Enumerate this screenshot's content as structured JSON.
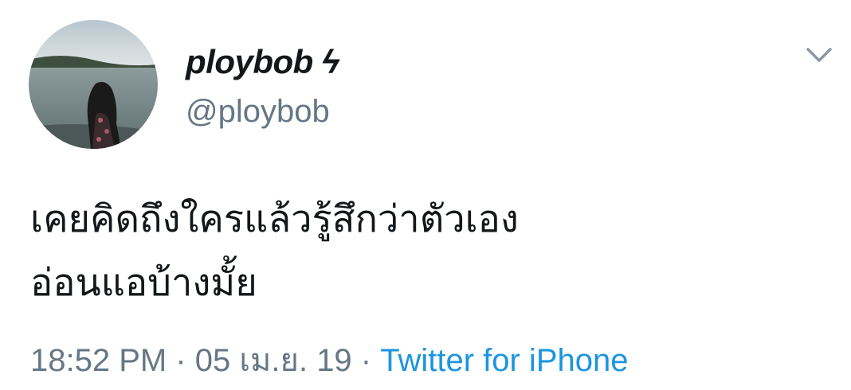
{
  "user": {
    "display_name": "ploybob ϟ",
    "handle": "@ploybob"
  },
  "tweet": {
    "line1": "เคยคิดถึงใครแล้วรู้สึกว่าตัวเอง",
    "line2": "อ่อนแอบ้างมั้ย"
  },
  "meta": {
    "time": "18:52 PM",
    "separator1": " · ",
    "date": "05 เม.ย. 19",
    "separator2": " · ",
    "source": "Twitter for iPhone"
  },
  "icons": {
    "menu": "chevron-down-icon",
    "avatar": "avatar"
  },
  "colors": {
    "text_primary": "#14171a",
    "text_secondary": "#657786",
    "link": "#1b95e0"
  }
}
